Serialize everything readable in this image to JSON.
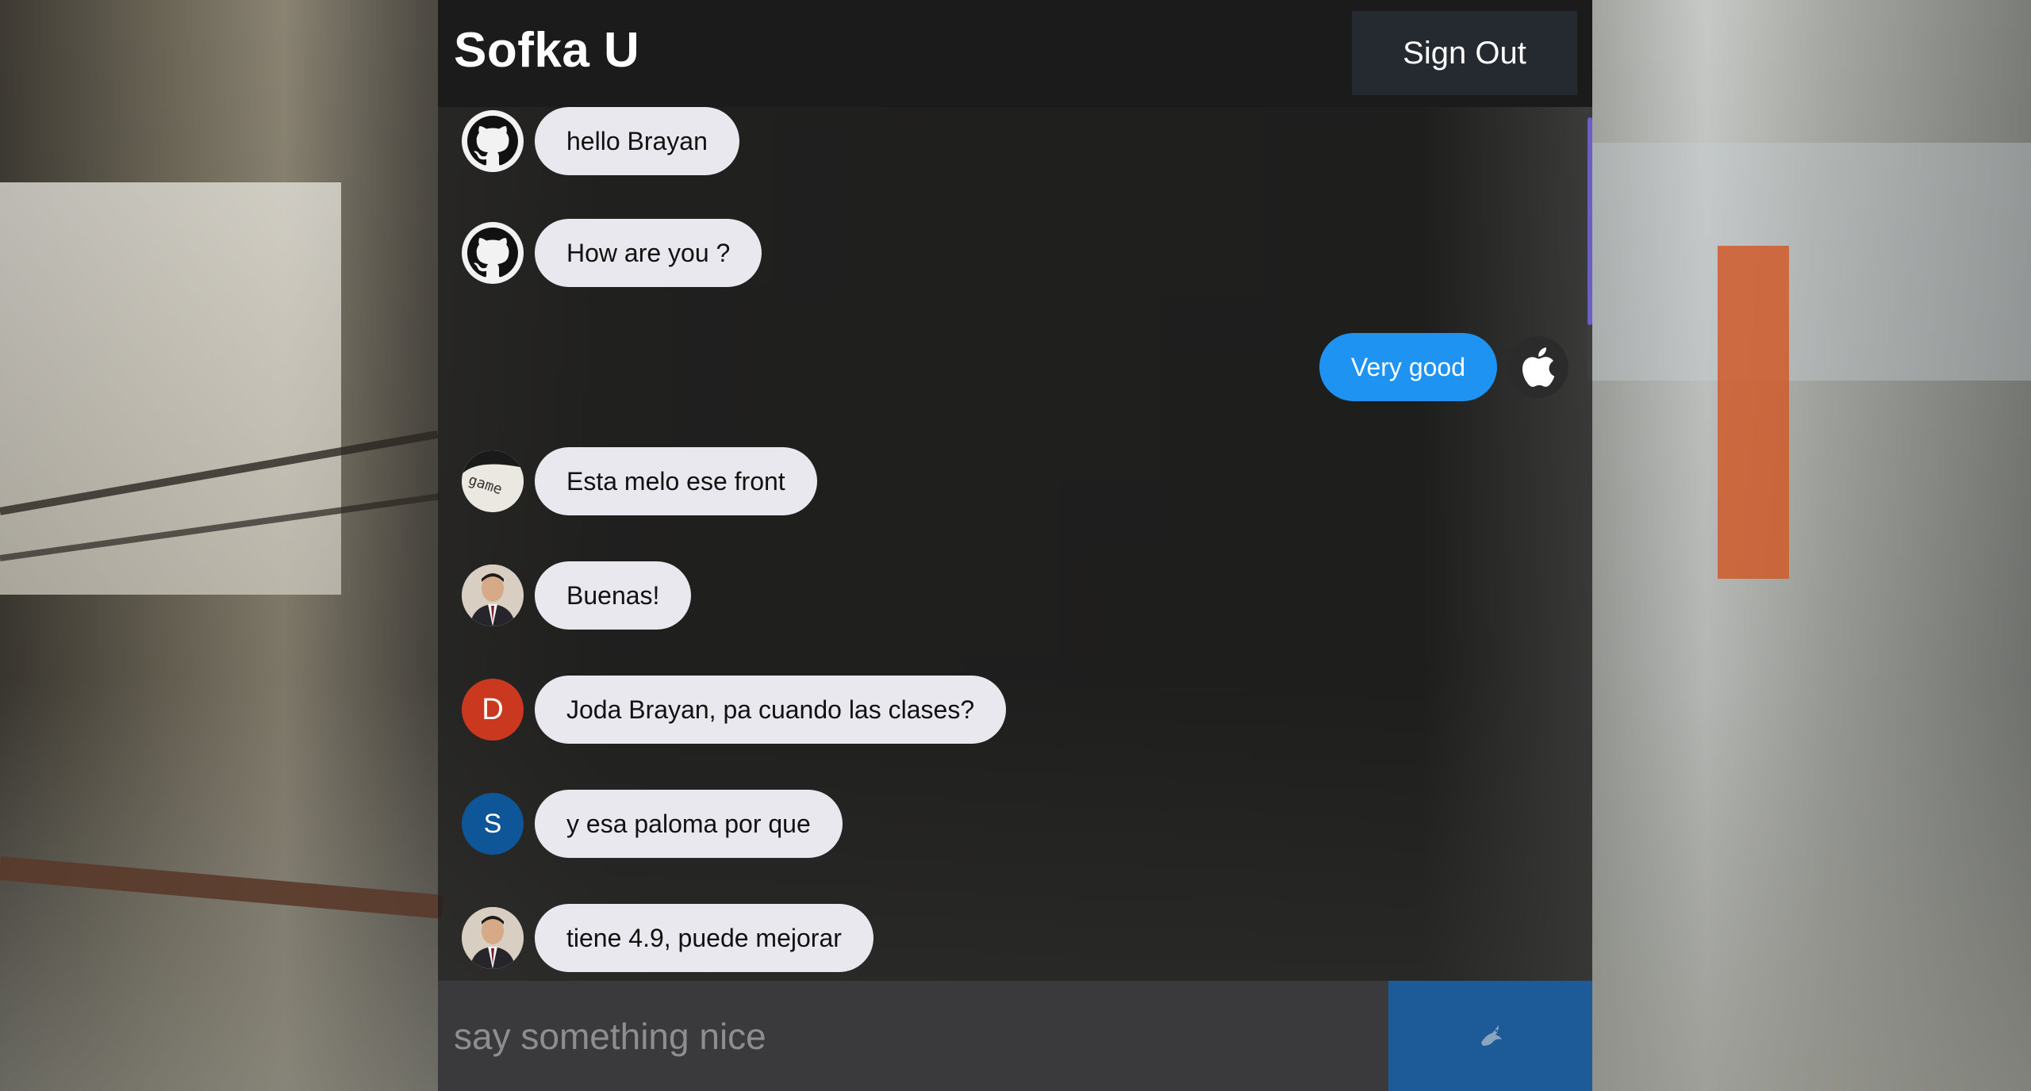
{
  "app": {
    "title": "Sofka U",
    "signout_label": "Sign Out"
  },
  "messages": [
    {
      "side": "incoming",
      "avatar": "github-icon",
      "text": "hello Brayan"
    },
    {
      "side": "incoming",
      "avatar": "github-icon",
      "text": "How are you ?"
    },
    {
      "side": "outgoing",
      "avatar": "apple-icon",
      "text": "Very good"
    },
    {
      "side": "incoming",
      "avatar": "gamer-avatar",
      "text": "Esta melo ese front"
    },
    {
      "side": "incoming",
      "avatar": "photo-avatar",
      "text": "Buenas!"
    },
    {
      "side": "incoming",
      "avatar": "letter-avatar",
      "letter": "D",
      "color": "#c9381f",
      "text": "Joda Brayan, pa cuando las clases?"
    },
    {
      "side": "incoming",
      "avatar": "letter-avatar",
      "letter": "S",
      "color": "#0f5698",
      "text": "y esa paloma por que"
    },
    {
      "side": "incoming",
      "avatar": "photo-avatar",
      "text": "tiene 4.9, puede mejorar"
    }
  ],
  "composer": {
    "placeholder": "say something nice",
    "send_icon": "dove-icon"
  },
  "colors": {
    "accent": "#1f93f1",
    "send_bg": "#1c5a98",
    "scrollbar": "#6b5fc7"
  }
}
